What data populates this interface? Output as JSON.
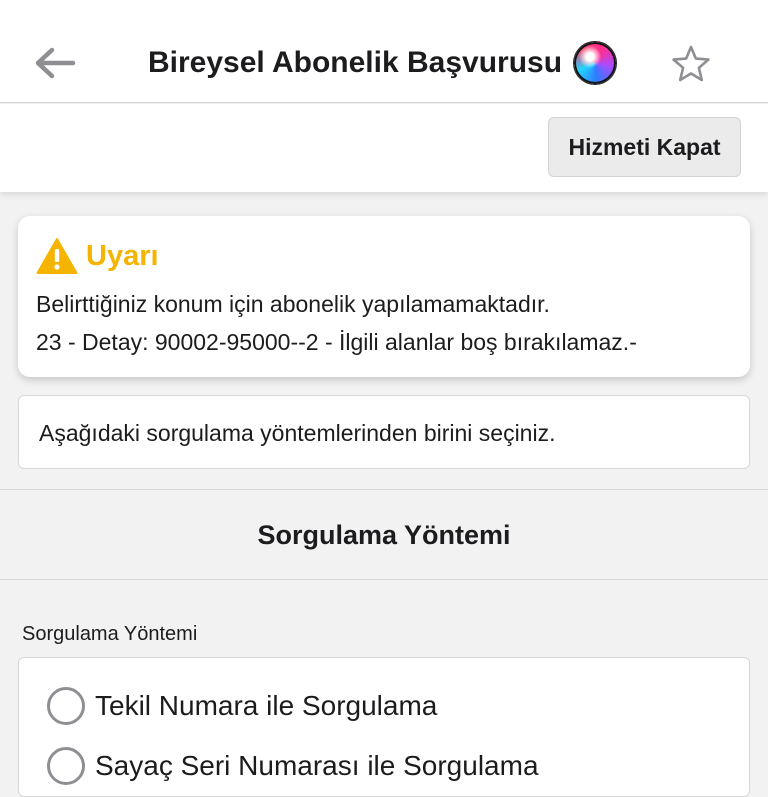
{
  "header": {
    "title": "Bireysel Abonelik Başvurusu",
    "back_icon": "arrow-left-icon",
    "assistant_icon": "siri-icon",
    "favorite_icon": "star-outline-icon"
  },
  "toolbar": {
    "close_service_label": "Hizmeti Kapat"
  },
  "warning": {
    "title": "Uyarı",
    "icon": "warning-triangle-icon",
    "line1": "Belirttiğiniz konum için abonelik yapılamamaktadır.",
    "line2": "23 - Detay: 90002-95000--2 - İlgili alanlar boş bırakılamaz.-",
    "title_color": "#f4b400"
  },
  "info": {
    "text": "Aşağıdaki sorgulama yöntemlerinden birini seçiniz."
  },
  "section": {
    "title": "Sorgulama Yöntemi"
  },
  "query_method": {
    "label": "Sorgulama Yöntemi",
    "options": [
      {
        "label": "Tekil Numara ile Sorgulama",
        "selected": false
      },
      {
        "label": "Sayaç Seri Numarası ile Sorgulama",
        "selected": false
      }
    ]
  }
}
